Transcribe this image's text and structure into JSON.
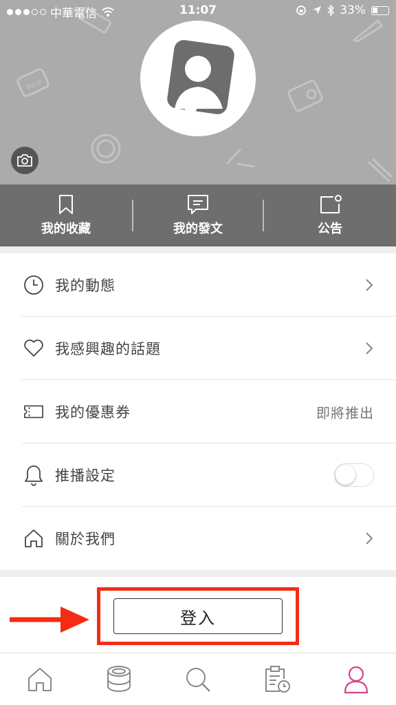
{
  "status_bar": {
    "carrier": "中華電信",
    "time": "11:07",
    "battery": "33%"
  },
  "profile": {
    "avatar_icon": "default-avatar-icon",
    "camera_icon": "camera-icon"
  },
  "actions": [
    {
      "label": "我的收藏",
      "icon": "bookmark-icon"
    },
    {
      "label": "我的發文",
      "icon": "message-icon"
    },
    {
      "label": "公告",
      "icon": "notice-icon"
    }
  ],
  "menu": [
    {
      "label": "我的動態",
      "icon": "clock-icon",
      "trailing": "chevron"
    },
    {
      "label": "我感興趣的話題",
      "icon": "heart-icon",
      "trailing": "chevron"
    },
    {
      "label": "我的優惠券",
      "icon": "ticket-icon",
      "trailing_text": "即將推出"
    },
    {
      "label": "推播設定",
      "icon": "bell-icon",
      "trailing": "toggle",
      "toggle_on": false
    },
    {
      "label": "關於我們",
      "icon": "home-icon",
      "trailing": "chevron"
    }
  ],
  "login": {
    "label": "登入"
  },
  "tabbar": {
    "items": [
      "home-icon",
      "compact-icon",
      "search-icon",
      "schedule-icon",
      "profile-icon"
    ],
    "active_index": 4
  },
  "colors": {
    "accent": "#d6418a",
    "highlight": "#f42c14",
    "cover_bg": "#ababab",
    "action_bar_bg": "#6e6e6e"
  }
}
